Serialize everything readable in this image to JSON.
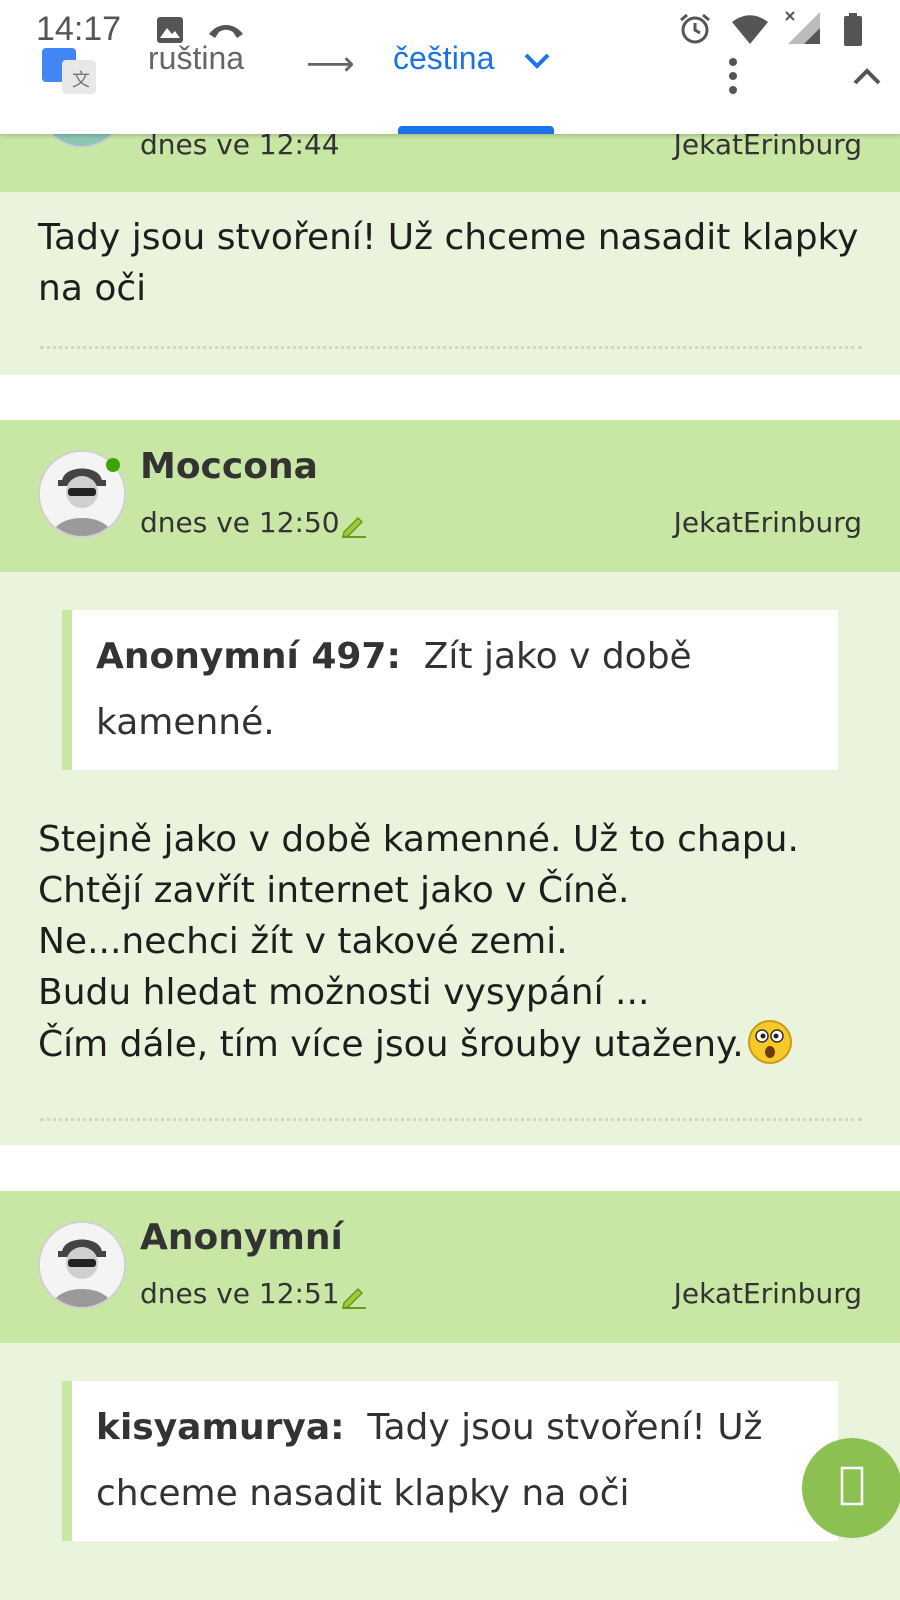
{
  "status_bar": {
    "time": "14:17",
    "left_icons": [
      "image-icon",
      "missed-call-icon"
    ],
    "right_icons": [
      "alarm-icon",
      "wifi-icon",
      "signal-icon",
      "battery-icon"
    ]
  },
  "translate_bar": {
    "source_language": "ruština",
    "arrow": "⟶",
    "target_language": "čeština"
  },
  "posts": [
    {
      "author": "",
      "date": "dnes ve 12:44",
      "city": "JekatErinburg",
      "body": "Tady jsou stvoření! Už chceme nasadit klapky na oči"
    },
    {
      "author": "Moccona",
      "online": true,
      "date": "dnes ve 12:50",
      "city": "JekatErinburg",
      "quote": {
        "author": "Anonymní 497:",
        "text": "Zít jako v době kamenné."
      },
      "body_lines": [
        "Stejně jako v době kamenné. Už to chapu.",
        "Chtějí zavřít internet jako v Číně.",
        "Ne...nechci žít v takové zemi.",
        "Budu hledat možnosti vysypání ...",
        "Čím dále, tím více jsou šrouby utaženy."
      ],
      "body_emoji": "surprised-smiley-icon"
    },
    {
      "author": "Anonymní",
      "date": "dnes ve 12:51",
      "city": "JekatErinburg",
      "quote": {
        "author": "kisyamurya:",
        "text": "Tady jsou stvoření! Už chceme nasadit klapky na oči"
      }
    }
  ],
  "colors": {
    "header_green": "#c9e7a4",
    "body_green": "#eaf3dc",
    "accent_blue": "#1a73e8",
    "fab_green": "#8cc152"
  }
}
